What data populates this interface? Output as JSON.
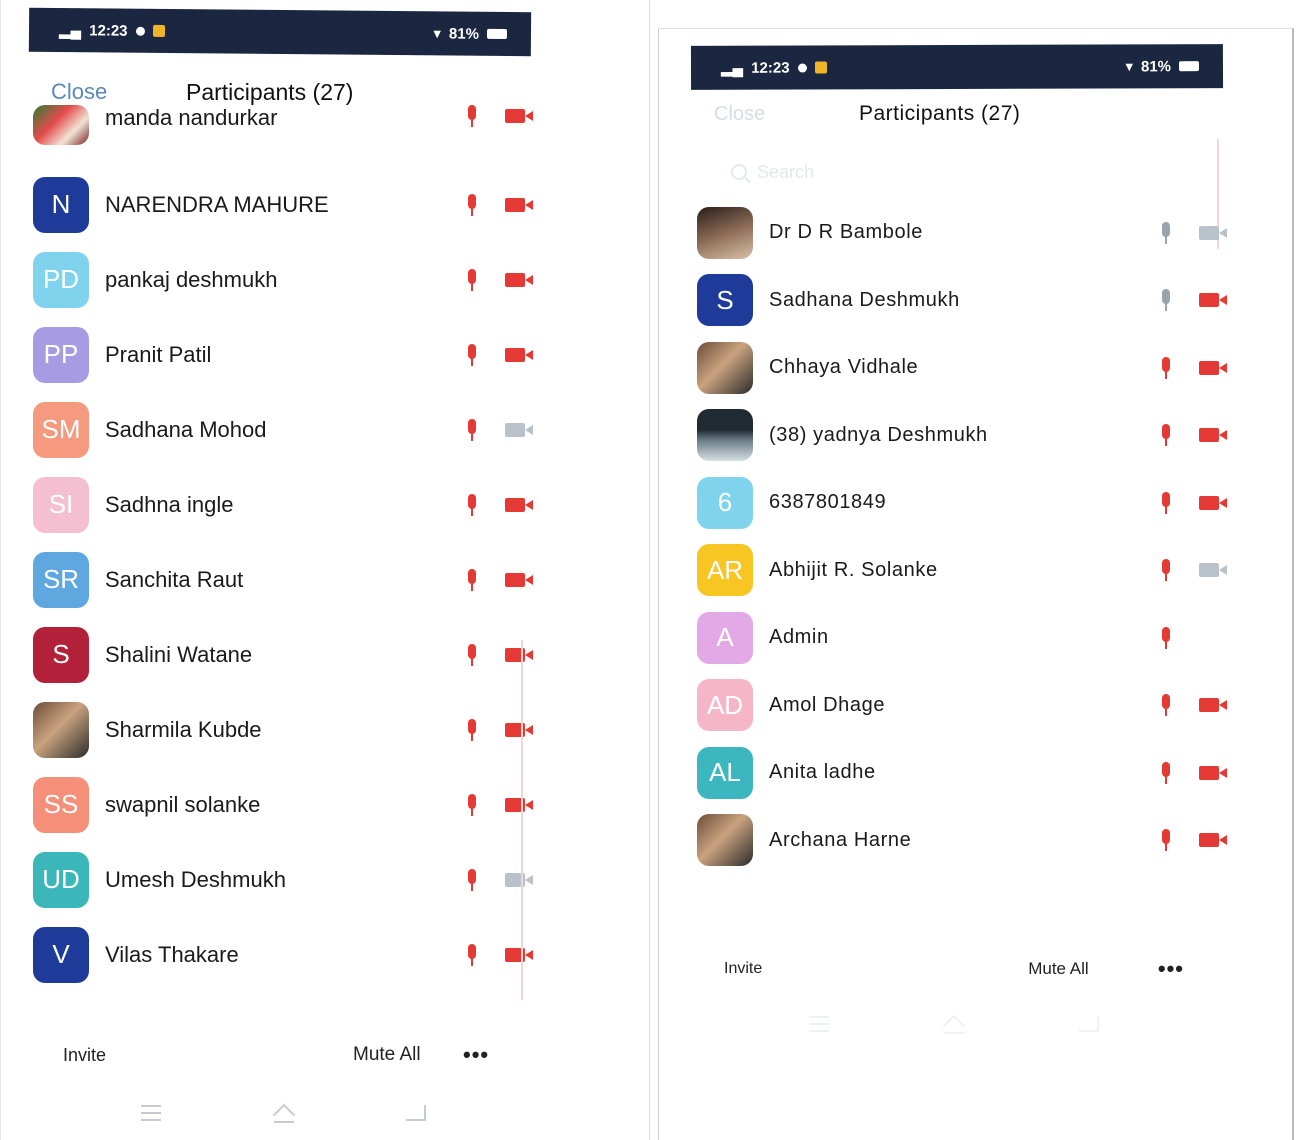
{
  "left_phone": {
    "status": {
      "time": "12:23",
      "battery": "81%"
    },
    "close_label": "Close",
    "title": "Participants (27)",
    "participants": [
      {
        "name": "manda nandurkar",
        "initials": "",
        "avatar_color": "#c0392b",
        "mic": "muted",
        "video": "off"
      },
      {
        "name": "NARENDRA MAHURE",
        "initials": "N",
        "avatar_color": "#1f3b9a",
        "mic": "muted",
        "video": "off"
      },
      {
        "name": "pankaj deshmukh",
        "initials": "PD",
        "avatar_color": "#7fd3ec",
        "mic": "muted",
        "video": "off"
      },
      {
        "name": "Pranit Patil",
        "initials": "PP",
        "avatar_color": "#a79be3",
        "mic": "muted",
        "video": "off"
      },
      {
        "name": "Sadhana Mohod",
        "initials": "SM",
        "avatar_color": "#f59a7f",
        "mic": "muted",
        "video": "idle"
      },
      {
        "name": "Sadhna ingle",
        "initials": "SI",
        "avatar_color": "#f4bfd0",
        "mic": "muted",
        "video": "off"
      },
      {
        "name": "Sanchita Raut",
        "initials": "SR",
        "avatar_color": "#5fa8df",
        "mic": "muted",
        "video": "off"
      },
      {
        "name": "Shalini Watane",
        "initials": "S",
        "avatar_color": "#b3203a",
        "mic": "muted",
        "video": "off"
      },
      {
        "name": "Sharmila Kubde",
        "initials": "",
        "avatar_color": "#6b4d3a",
        "mic": "muted",
        "video": "off"
      },
      {
        "name": "swapnil solanke",
        "initials": "SS",
        "avatar_color": "#f58f7a",
        "mic": "muted",
        "video": "off"
      },
      {
        "name": "Umesh Deshmukh",
        "initials": "UD",
        "avatar_color": "#3cb7b9",
        "mic": "muted",
        "video": "idle"
      },
      {
        "name": "Vilas Thakare",
        "initials": "V",
        "avatar_color": "#1f3b9a",
        "mic": "muted",
        "video": "off"
      }
    ],
    "footer": {
      "invite": "Invite",
      "mute_all": "Mute All",
      "more": "•••"
    }
  },
  "right_phone": {
    "status": {
      "time": "12:23",
      "battery": "81%"
    },
    "close_label": "Close",
    "title": "Participants (27)",
    "search_placeholder": "Search",
    "participants": [
      {
        "name": "Dr D R Bambole",
        "initials": "",
        "avatar_color": "#2a1d18",
        "mic": "idle",
        "video": "idle"
      },
      {
        "name": "Sadhana Deshmukh",
        "initials": "S",
        "avatar_color": "#1f3b9a",
        "mic": "idle",
        "video": "off"
      },
      {
        "name": "Chhaya Vidhale",
        "initials": "",
        "avatar_color": "#8a6a55",
        "mic": "muted",
        "video": "off"
      },
      {
        "name": "(38) yadnya Deshmukh",
        "initials": "",
        "avatar_color": "#1f2a33",
        "mic": "muted",
        "video": "off"
      },
      {
        "name": "6387801849",
        "initials": "6",
        "avatar_color": "#7fd3ec",
        "mic": "muted",
        "video": "off"
      },
      {
        "name": "Abhijit R. Solanke",
        "initials": "AR",
        "avatar_color": "#f7c623",
        "mic": "muted",
        "video": "idle"
      },
      {
        "name": "Admin",
        "initials": "A",
        "avatar_color": "#e3a9e6",
        "mic": "muted",
        "video": "none"
      },
      {
        "name": "Amol Dhage",
        "initials": "AD",
        "avatar_color": "#f5b7c8",
        "mic": "muted",
        "video": "off"
      },
      {
        "name": "Anita ladhe",
        "initials": "AL",
        "avatar_color": "#3cb7c0",
        "mic": "muted",
        "video": "off"
      },
      {
        "name": "Archana Harne",
        "initials": "",
        "avatar_color": "#6b4d3a",
        "mic": "muted",
        "video": "off"
      }
    ],
    "footer": {
      "invite": "Invite",
      "mute_all": "Mute All",
      "more": "•••"
    }
  }
}
